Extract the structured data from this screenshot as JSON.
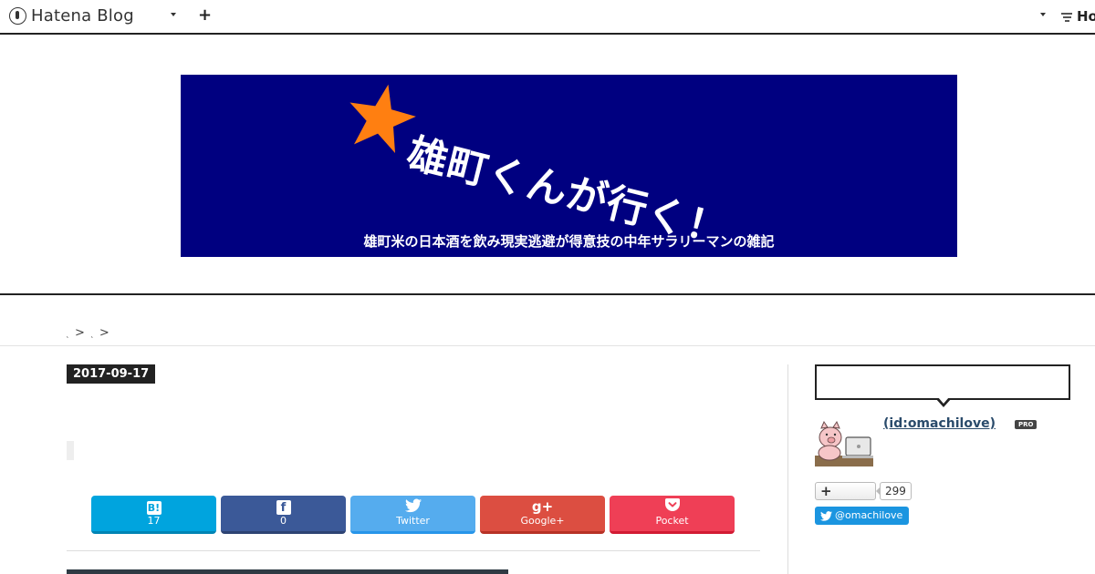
{
  "topbar": {
    "logo_text": "Hatena Blog",
    "add_label": "+",
    "right_brand_text": "Ho"
  },
  "banner": {
    "title": "雄町くんが行く！",
    "subtitle": "雄町米の日本酒を飲み現実逃避が得意技の中年サラリーマンの雑記",
    "star_color": "#ff7f11",
    "bg_color": "#000080"
  },
  "breadcrumb": {
    "separators": [
      ">",
      ">"
    ]
  },
  "article": {
    "date": "2017-09-17"
  },
  "share": {
    "hatena": {
      "icon": "B!",
      "label": "17"
    },
    "facebook": {
      "icon": "f",
      "label": "0"
    },
    "twitter": {
      "label": "Twitter"
    },
    "google": {
      "icon": "g+",
      "label": "Google+"
    },
    "pocket": {
      "label": "Pocket"
    }
  },
  "sidebar": {
    "profile_id": "(id:omachilove)",
    "pro_badge": "PRO",
    "follow_icon": "+",
    "follower_count": "299",
    "twitter_handle": "@omachilove"
  }
}
